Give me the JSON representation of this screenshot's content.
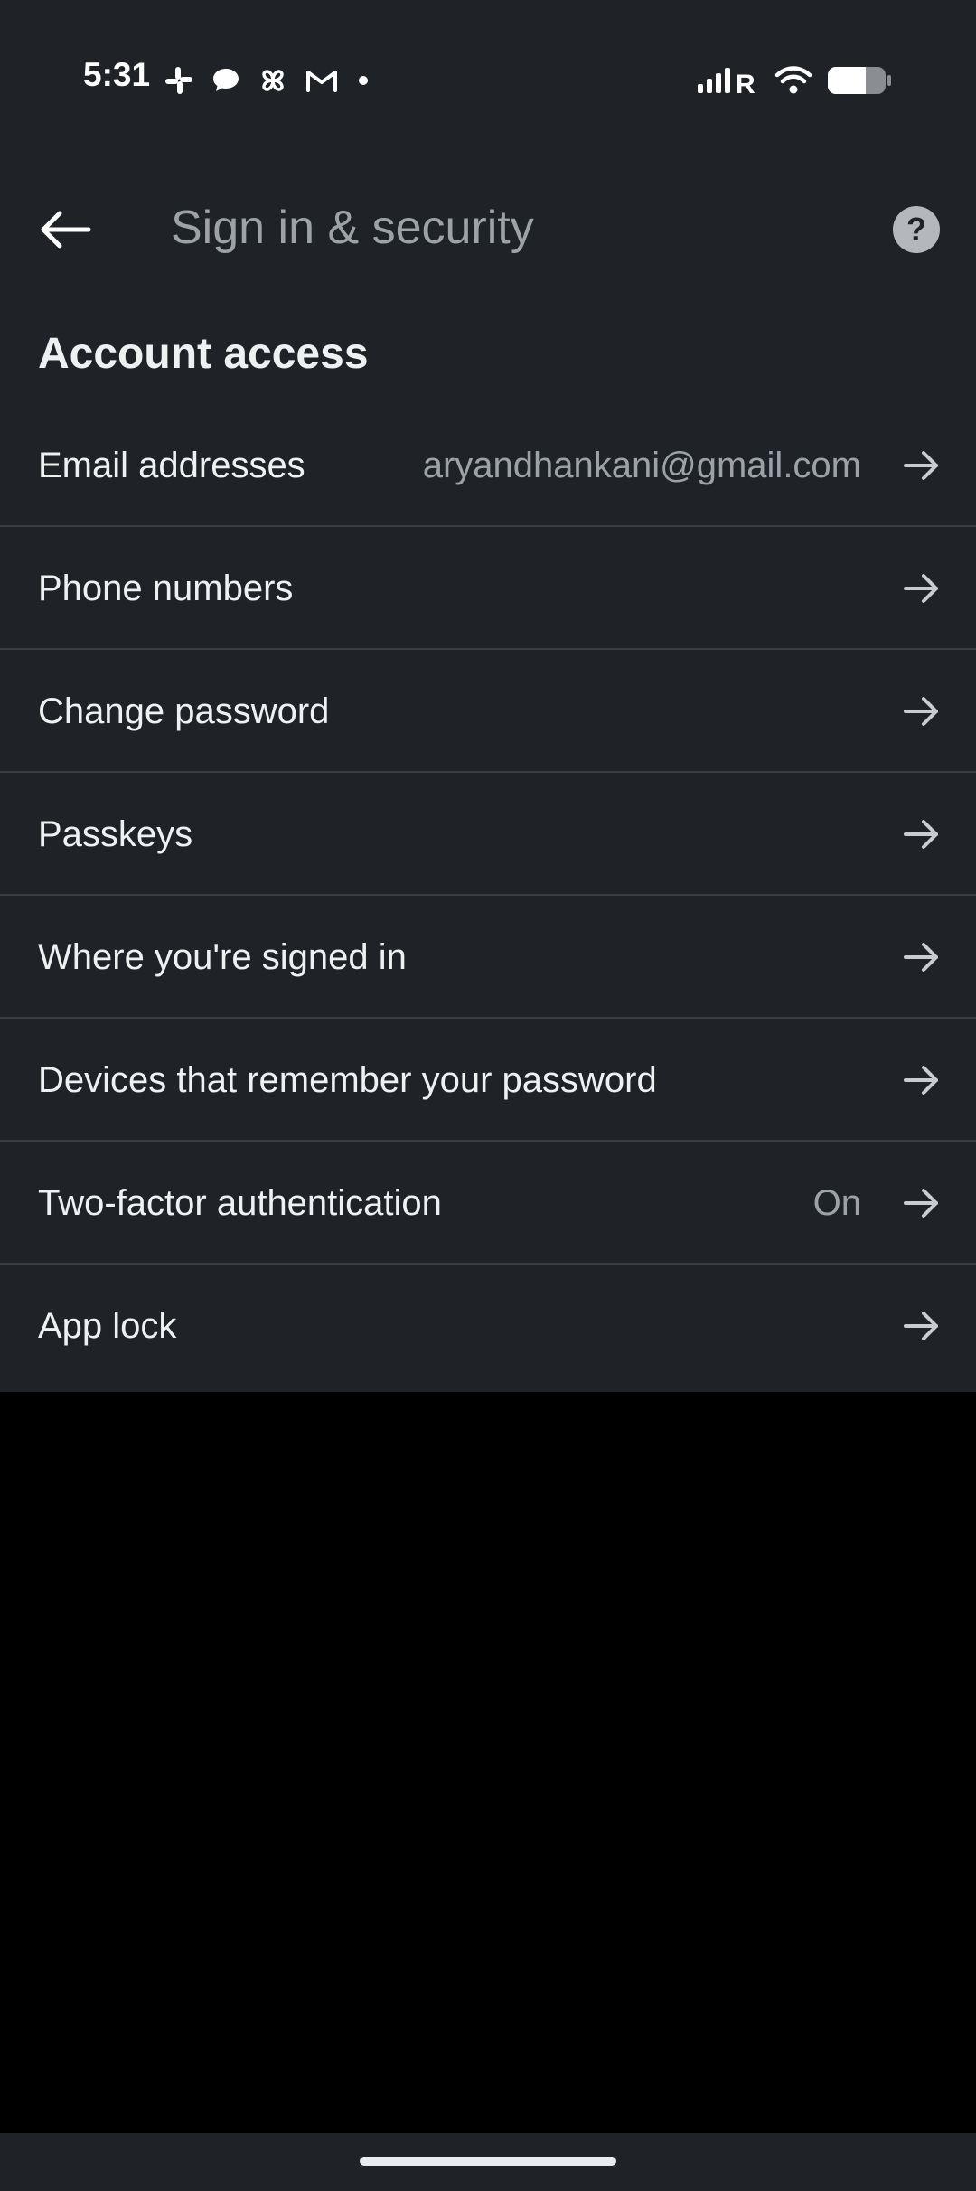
{
  "status_bar": {
    "time": "5:31",
    "left_icons": [
      "slack-icon",
      "chat-bubble-icon",
      "pinwheel-icon",
      "gmail-icon",
      "dot-icon"
    ],
    "right_icons": [
      "signal-roaming-icon",
      "wifi-icon",
      "battery-icon"
    ],
    "roaming_label": "R"
  },
  "app_bar": {
    "title": "Sign in & security",
    "back_icon": "arrow-left-icon",
    "help_icon": "help-circle-icon"
  },
  "section": {
    "title": "Account access"
  },
  "rows": [
    {
      "label": "Email addresses",
      "value": "aryandhankani@gmail.com"
    },
    {
      "label": "Phone numbers",
      "value": ""
    },
    {
      "label": "Change password",
      "value": ""
    },
    {
      "label": "Passkeys",
      "value": ""
    },
    {
      "label": "Where you're signed in",
      "value": ""
    },
    {
      "label": "Devices that remember your password",
      "value": ""
    },
    {
      "label": "Two-factor authentication",
      "value": "On"
    },
    {
      "label": "App lock",
      "value": ""
    }
  ],
  "colors": {
    "surface": "#1f2226",
    "background": "#000000",
    "text_primary": "#eef0f2",
    "text_secondary": "#9da2a7",
    "divider": "#3a3e43"
  }
}
